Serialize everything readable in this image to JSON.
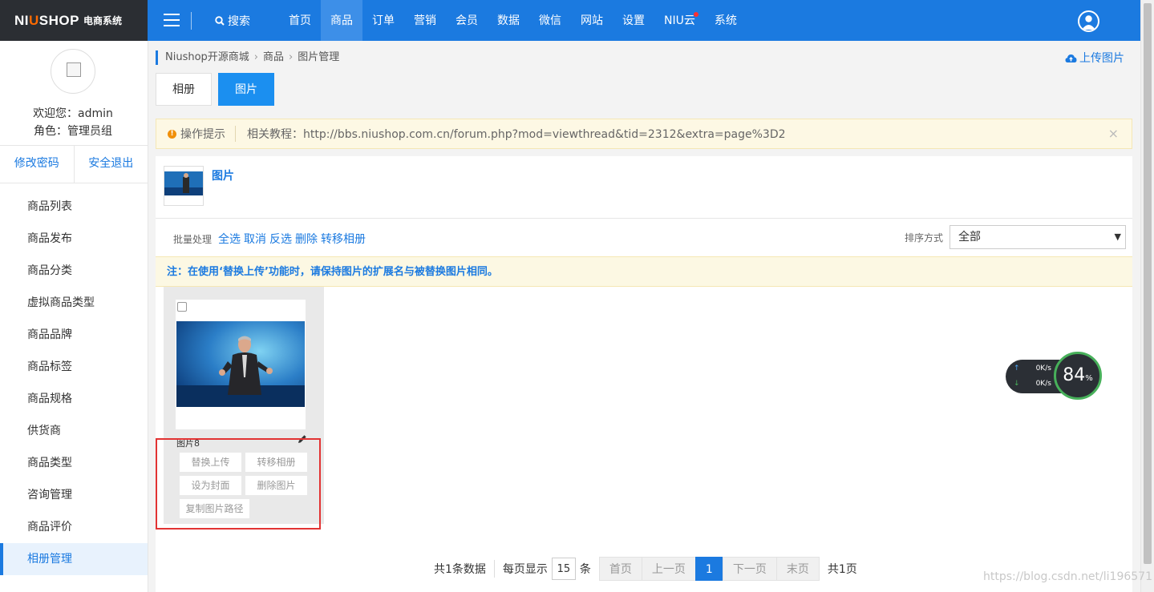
{
  "app": {
    "brand_a": "NI",
    "brand_o": "U",
    "brand_b": "SHOP",
    "brand_sys": "电商系统"
  },
  "topbar": {
    "search_label": "搜索",
    "nav": [
      {
        "label": "首页"
      },
      {
        "label": "商品"
      },
      {
        "label": "订单"
      },
      {
        "label": "营销"
      },
      {
        "label": "会员"
      },
      {
        "label": "数据"
      },
      {
        "label": "微信"
      },
      {
        "label": "网站"
      },
      {
        "label": "设置"
      },
      {
        "label": "NIU云"
      },
      {
        "label": "系统"
      }
    ],
    "active_index": 1
  },
  "sidebar": {
    "welcome": "欢迎您：admin",
    "role": "角色：管理员组",
    "change_password": "修改密码",
    "logout": "安全退出",
    "items": [
      {
        "label": "商品列表"
      },
      {
        "label": "商品发布"
      },
      {
        "label": "商品分类"
      },
      {
        "label": "虚拟商品类型"
      },
      {
        "label": "商品品牌"
      },
      {
        "label": "商品标签"
      },
      {
        "label": "商品规格"
      },
      {
        "label": "供货商"
      },
      {
        "label": "商品类型"
      },
      {
        "label": "咨询管理"
      },
      {
        "label": "商品评价"
      },
      {
        "label": "相册管理"
      }
    ]
  },
  "breadcrumb": {
    "root": "Niushop开源商城",
    "level1": "商品",
    "level2": "图片管理"
  },
  "upload_label": "上传图片",
  "tabs": [
    {
      "label": "相册"
    },
    {
      "label": "图片"
    }
  ],
  "tip": {
    "label": "操作提示",
    "text": "相关教程：http://bbs.niushop.com.cn/forum.php?mod=viewthread&tid=2312&extra=page%3D2",
    "close": "×"
  },
  "album": {
    "title": "图片"
  },
  "batch": {
    "label": "批量处理",
    "select_all": "全选",
    "cancel": "取消",
    "invert": "反选",
    "delete": "删除",
    "move": "转移相册"
  },
  "sort": {
    "label": "排序方式",
    "value": "全部"
  },
  "note": "注：在使用‘替换上传’功能时，请保持图片的扩展名与被替换图片相同。",
  "card": {
    "name": "图片8",
    "replace": "替换上传",
    "move": "转移相册",
    "cover": "设为封面",
    "delete": "删除图片",
    "copy_path": "复制图片路径"
  },
  "pager": {
    "total": "共1条数据",
    "per_label": "每页显示",
    "per_value": "15",
    "per_unit": "条",
    "first": "首页",
    "prev": "上一页",
    "current": "1",
    "next": "下一页",
    "last": "末页",
    "pages": "共1页"
  },
  "speed": {
    "up": "0K/s",
    "down": "0K/s",
    "percent": "84",
    "percent_unit": "%"
  },
  "watermark": "https://blog.csdn.net/li196571"
}
